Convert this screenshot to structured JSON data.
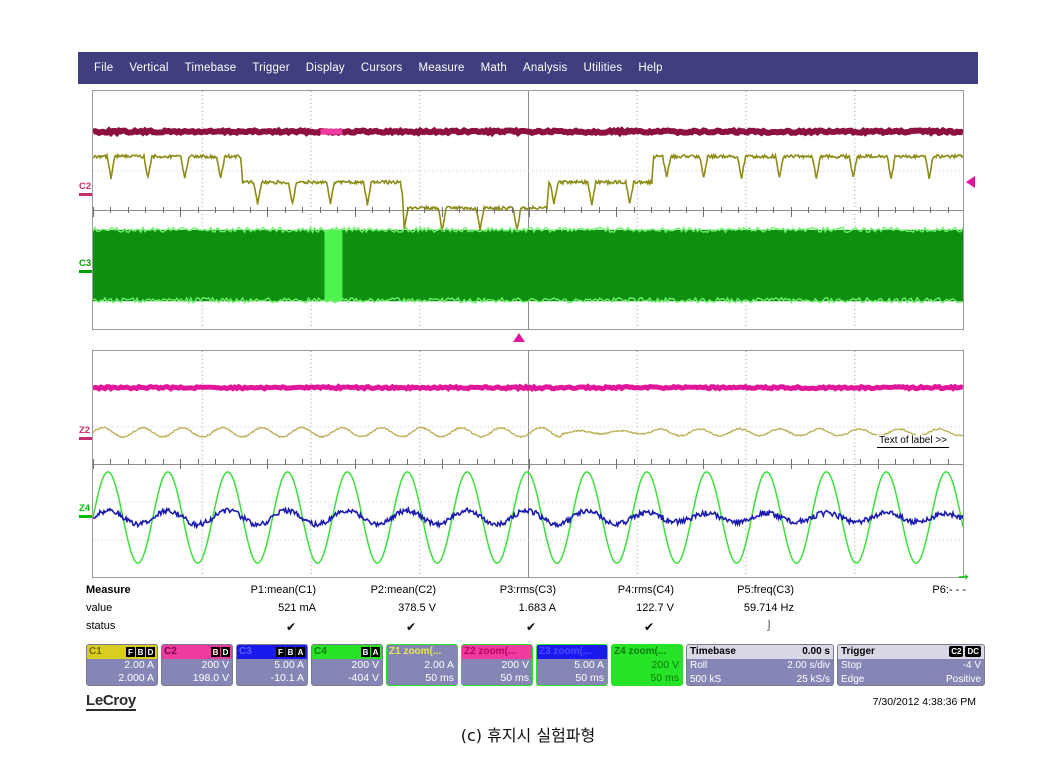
{
  "menu": {
    "items": [
      "File",
      "Vertical",
      "Timebase",
      "Trigger",
      "Display",
      "Cursors",
      "Measure",
      "Math",
      "Analysis",
      "Utilities",
      "Help"
    ]
  },
  "grids": {
    "upper": {
      "channel_markers": [
        {
          "id": "C2",
          "color": "#c62f6e",
          "y_frac": 0.4
        },
        {
          "id": "C3",
          "color": "#00a000",
          "y_frac": 0.705
        }
      ]
    },
    "lower": {
      "channel_markers": [
        {
          "id": "Z2",
          "color": "#c62f6e",
          "y_frac": 0.355
        },
        {
          "id": "Z4",
          "color": "#00c000",
          "y_frac": 0.7
        }
      ],
      "annotation": "Text of label >>"
    }
  },
  "measure": {
    "title": "Measure",
    "row_labels": [
      "value",
      "status"
    ],
    "columns": [
      {
        "name": "P1:mean(C1)",
        "value": "521 mA",
        "status": "check"
      },
      {
        "name": "P2:mean(C2)",
        "value": "378.5 V",
        "status": "check"
      },
      {
        "name": "P3:rms(C3)",
        "value": "1.683 A",
        "status": "check"
      },
      {
        "name": "P4:rms(C4)",
        "value": "122.7 V",
        "status": "check"
      },
      {
        "name": "P5:freq(C3)",
        "value": "59.714 Hz",
        "status": "pulse"
      },
      {
        "name": "P6:- - -",
        "value": "",
        "status": ""
      }
    ]
  },
  "descriptors": [
    {
      "name": "C1",
      "header_bg": "#d9cc22",
      "header_fg": "#6b6b00",
      "badges": [
        "F",
        "B",
        "D"
      ],
      "badge_style": "dark",
      "line1": "2.00 A",
      "line2": "2.000 A"
    },
    {
      "name": "C2",
      "header_bg": "#ef3ba0",
      "header_fg": "#7a0044",
      "badges": [
        "B",
        "D"
      ],
      "badge_style": "dark",
      "line1": "200 V",
      "line2": "198.0 V"
    },
    {
      "name": "C3",
      "header_bg": "#1a1aee",
      "header_fg": "#5b5bff",
      "badges": [
        "F",
        "B",
        "A"
      ],
      "badge_style": "dark",
      "line1": "5.00 A",
      "line2": "-10.1 A"
    },
    {
      "name": "C4",
      "header_bg": "#27e327",
      "header_fg": "#0c7a0c",
      "badges": [
        "B",
        "A"
      ],
      "badge_style": "dark",
      "line1": "200 V",
      "line2": "-404 V"
    },
    {
      "name": "Z1 zoom(...",
      "header_bg": "#8586b5",
      "header_fg": "#e8e84a",
      "badges": [],
      "badge_style": "none",
      "line1": "2.00 A",
      "line2": "50 ms",
      "border": "#27e327"
    },
    {
      "name": "Z2 zoom(...",
      "header_bg": "#ef3ba0",
      "header_fg": "#b8005f",
      "badges": [],
      "badge_style": "none",
      "line1": "200 V",
      "line2": "50 ms",
      "border": "#27e327"
    },
    {
      "name": "Z3 zoom(...",
      "header_bg": "#1a1aee",
      "header_fg": "#4a4aff",
      "badges": [],
      "badge_style": "none",
      "line1": "5.00 A",
      "line2": "50 ms",
      "border": "#27e327"
    },
    {
      "name": "Z4 zoom(...",
      "header_bg": "#27e327",
      "header_fg": "#0c7a0c",
      "badges": [],
      "badge_style": "none",
      "line1": "200 V",
      "line2": "50 ms",
      "border": "#27e327",
      "body_bg": "#27e327",
      "body_fg": "#0c7a0c"
    }
  ],
  "timebase": {
    "title": "Timebase",
    "title_value": "0.00 s",
    "mode": "Roll",
    "mode_value": "2.00 s/div",
    "memory": "500 kS",
    "rate": "25 kS/s"
  },
  "trigger": {
    "title": "Trigger",
    "source_badges": [
      "C2",
      "DC"
    ],
    "state": "Stop",
    "level": "-4 V",
    "slope_label": "Edge",
    "slope_value": "Positive"
  },
  "footer": {
    "logo": "LeCroy",
    "timestamp": "7/30/2012 4:38:36 PM"
  },
  "caption": "(c) 휴지시  실험파형",
  "colors": {
    "menu_bg": "#3f3f7f",
    "c1": "#8c8c17",
    "c2": "#8c1040",
    "c3": "#0f8f0f",
    "c4": "#2ee82e",
    "z1": "#bdb25a",
    "z2": "#e0179b",
    "z3": "#1b1bb0",
    "z4": "#3ce03c",
    "trigger_marker": "#e0179b"
  }
}
